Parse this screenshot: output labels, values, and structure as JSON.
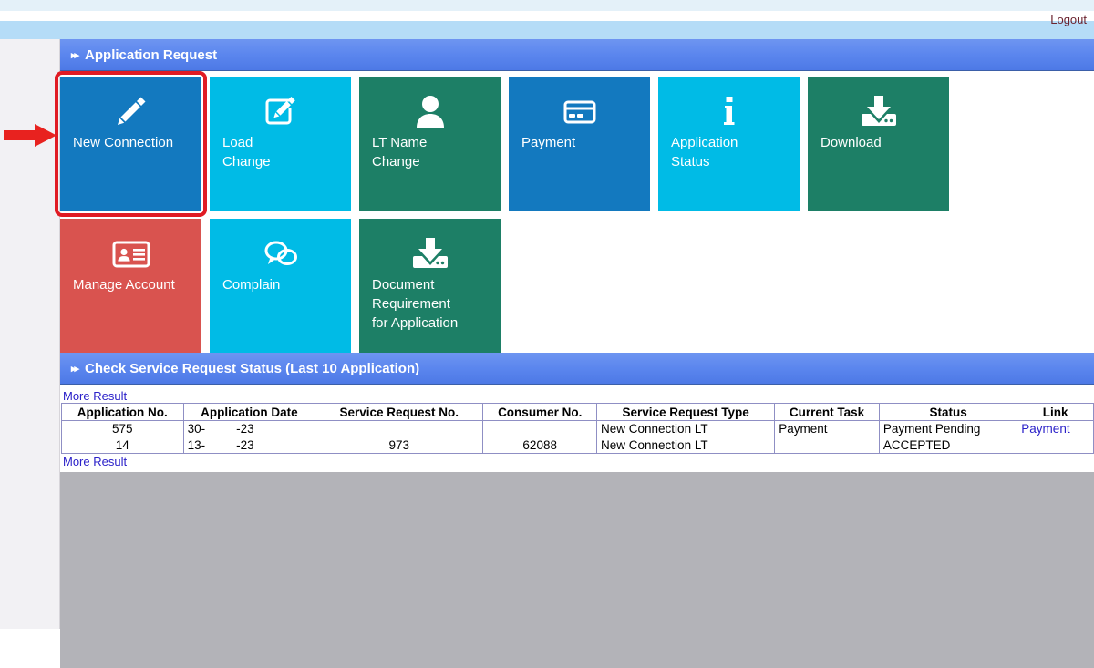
{
  "topbar": {
    "logout_label": "Logout"
  },
  "sections": {
    "application_request": {
      "title": "Application Request",
      "bullet": "▸▸"
    },
    "service_status": {
      "title": "Check Service Request Status (Last 10 Application)",
      "bullet": "▸▸"
    }
  },
  "tiles": [
    {
      "label": "New Connection",
      "icon": "pencil-icon",
      "color": "#1379bf",
      "highlighted": true
    },
    {
      "label": "Load\nChange",
      "icon": "edit-square-icon",
      "color": "#00bbe6",
      "highlighted": false
    },
    {
      "label": "LT Name\nChange",
      "icon": "user-icon",
      "color": "#1d7f66",
      "highlighted": false
    },
    {
      "label": "Payment",
      "icon": "credit-card-icon",
      "color": "#1379bf",
      "highlighted": false
    },
    {
      "label": "Application\nStatus",
      "icon": "info-icon",
      "color": "#00bbe6",
      "highlighted": false
    },
    {
      "label": "Download",
      "icon": "download-icon",
      "color": "#1d7f66",
      "highlighted": false
    },
    {
      "label": "Manage Account",
      "icon": "id-card-icon",
      "color": "#d9534f",
      "highlighted": false
    },
    {
      "label": "Complain",
      "icon": "chat-bubbles-icon",
      "color": "#00bbe6",
      "highlighted": false
    },
    {
      "label": "Document\nRequirement\nfor Application",
      "icon": "download-icon",
      "color": "#1d7f66",
      "highlighted": false
    }
  ],
  "links": {
    "more_result_top": "More Result",
    "more_result_bottom": "More Result"
  },
  "table": {
    "columns": [
      "Application No.",
      "Application Date",
      "Service Request No.",
      "Consumer No.",
      "Service Request Type",
      "Current Task",
      "Status",
      "Link"
    ],
    "rows": [
      {
        "application_no": "575",
        "application_date_prefix": "30-",
        "application_date_suffix": "-23",
        "service_request_no": "",
        "consumer_no": "",
        "service_request_type": "New Connection LT",
        "current_task": "Payment",
        "status": "Payment Pending",
        "link": "Payment"
      },
      {
        "application_no": "14",
        "application_date_prefix": "13-",
        "application_date_suffix": "-23",
        "service_request_no": "973",
        "consumer_no": "62088",
        "service_request_type": "New Connection LT",
        "current_task": "",
        "status": "ACCEPTED",
        "link": ""
      }
    ]
  },
  "annotation": {
    "arrow_color": "#e8221f",
    "highlight_color": "#e01b24",
    "arrow_target": "New Connection"
  }
}
